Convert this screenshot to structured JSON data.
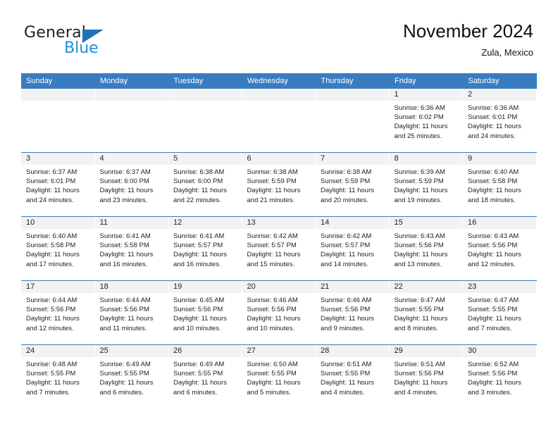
{
  "brand": {
    "name_primary": "General",
    "name_secondary": "Blue",
    "triangle_color": "#1f71b8",
    "secondary_color": "#1f8fd6"
  },
  "header": {
    "title": "November 2024",
    "subtitle": "Zula, Mexico"
  },
  "theme": {
    "header_row_bg": "#3a7cc0",
    "daynum_band_bg": "#f2f2f2",
    "grid_line": "#3a7cc0",
    "text": "#222222"
  },
  "weekday_headers": [
    "Sunday",
    "Monday",
    "Tuesday",
    "Wednesday",
    "Thursday",
    "Friday",
    "Saturday"
  ],
  "labels": {
    "sunrise_prefix": "Sunrise:",
    "sunset_prefix": "Sunset:",
    "daylight_prefix": "Daylight:"
  },
  "weeks": [
    [
      {
        "day": "",
        "empty": true
      },
      {
        "day": "",
        "empty": true
      },
      {
        "day": "",
        "empty": true
      },
      {
        "day": "",
        "empty": true
      },
      {
        "day": "",
        "empty": true
      },
      {
        "day": "1",
        "sunrise": "Sunrise: 6:36 AM",
        "sunset": "Sunset: 6:02 PM",
        "daylight": "Daylight: 11 hours and 25 minutes."
      },
      {
        "day": "2",
        "sunrise": "Sunrise: 6:36 AM",
        "sunset": "Sunset: 6:01 PM",
        "daylight": "Daylight: 11 hours and 24 minutes."
      }
    ],
    [
      {
        "day": "3",
        "sunrise": "Sunrise: 6:37 AM",
        "sunset": "Sunset: 6:01 PM",
        "daylight": "Daylight: 11 hours and 24 minutes."
      },
      {
        "day": "4",
        "sunrise": "Sunrise: 6:37 AM",
        "sunset": "Sunset: 6:00 PM",
        "daylight": "Daylight: 11 hours and 23 minutes."
      },
      {
        "day": "5",
        "sunrise": "Sunrise: 6:38 AM",
        "sunset": "Sunset: 6:00 PM",
        "daylight": "Daylight: 11 hours and 22 minutes."
      },
      {
        "day": "6",
        "sunrise": "Sunrise: 6:38 AM",
        "sunset": "Sunset: 5:59 PM",
        "daylight": "Daylight: 11 hours and 21 minutes."
      },
      {
        "day": "7",
        "sunrise": "Sunrise: 6:38 AM",
        "sunset": "Sunset: 5:59 PM",
        "daylight": "Daylight: 11 hours and 20 minutes."
      },
      {
        "day": "8",
        "sunrise": "Sunrise: 6:39 AM",
        "sunset": "Sunset: 5:59 PM",
        "daylight": "Daylight: 11 hours and 19 minutes."
      },
      {
        "day": "9",
        "sunrise": "Sunrise: 6:40 AM",
        "sunset": "Sunset: 5:58 PM",
        "daylight": "Daylight: 11 hours and 18 minutes."
      }
    ],
    [
      {
        "day": "10",
        "sunrise": "Sunrise: 6:40 AM",
        "sunset": "Sunset: 5:58 PM",
        "daylight": "Daylight: 11 hours and 17 minutes."
      },
      {
        "day": "11",
        "sunrise": "Sunrise: 6:41 AM",
        "sunset": "Sunset: 5:58 PM",
        "daylight": "Daylight: 11 hours and 16 minutes."
      },
      {
        "day": "12",
        "sunrise": "Sunrise: 6:41 AM",
        "sunset": "Sunset: 5:57 PM",
        "daylight": "Daylight: 11 hours and 16 minutes."
      },
      {
        "day": "13",
        "sunrise": "Sunrise: 6:42 AM",
        "sunset": "Sunset: 5:57 PM",
        "daylight": "Daylight: 11 hours and 15 minutes."
      },
      {
        "day": "14",
        "sunrise": "Sunrise: 6:42 AM",
        "sunset": "Sunset: 5:57 PM",
        "daylight": "Daylight: 11 hours and 14 minutes."
      },
      {
        "day": "15",
        "sunrise": "Sunrise: 6:43 AM",
        "sunset": "Sunset: 5:56 PM",
        "daylight": "Daylight: 11 hours and 13 minutes."
      },
      {
        "day": "16",
        "sunrise": "Sunrise: 6:43 AM",
        "sunset": "Sunset: 5:56 PM",
        "daylight": "Daylight: 11 hours and 12 minutes."
      }
    ],
    [
      {
        "day": "17",
        "sunrise": "Sunrise: 6:44 AM",
        "sunset": "Sunset: 5:56 PM",
        "daylight": "Daylight: 11 hours and 12 minutes."
      },
      {
        "day": "18",
        "sunrise": "Sunrise: 6:44 AM",
        "sunset": "Sunset: 5:56 PM",
        "daylight": "Daylight: 11 hours and 11 minutes."
      },
      {
        "day": "19",
        "sunrise": "Sunrise: 6:45 AM",
        "sunset": "Sunset: 5:56 PM",
        "daylight": "Daylight: 11 hours and 10 minutes."
      },
      {
        "day": "20",
        "sunrise": "Sunrise: 6:46 AM",
        "sunset": "Sunset: 5:56 PM",
        "daylight": "Daylight: 11 hours and 10 minutes."
      },
      {
        "day": "21",
        "sunrise": "Sunrise: 6:46 AM",
        "sunset": "Sunset: 5:56 PM",
        "daylight": "Daylight: 11 hours and 9 minutes."
      },
      {
        "day": "22",
        "sunrise": "Sunrise: 6:47 AM",
        "sunset": "Sunset: 5:55 PM",
        "daylight": "Daylight: 11 hours and 8 minutes."
      },
      {
        "day": "23",
        "sunrise": "Sunrise: 6:47 AM",
        "sunset": "Sunset: 5:55 PM",
        "daylight": "Daylight: 11 hours and 7 minutes."
      }
    ],
    [
      {
        "day": "24",
        "sunrise": "Sunrise: 6:48 AM",
        "sunset": "Sunset: 5:55 PM",
        "daylight": "Daylight: 11 hours and 7 minutes."
      },
      {
        "day": "25",
        "sunrise": "Sunrise: 6:49 AM",
        "sunset": "Sunset: 5:55 PM",
        "daylight": "Daylight: 11 hours and 6 minutes."
      },
      {
        "day": "26",
        "sunrise": "Sunrise: 6:49 AM",
        "sunset": "Sunset: 5:55 PM",
        "daylight": "Daylight: 11 hours and 6 minutes."
      },
      {
        "day": "27",
        "sunrise": "Sunrise: 6:50 AM",
        "sunset": "Sunset: 5:55 PM",
        "daylight": "Daylight: 11 hours and 5 minutes."
      },
      {
        "day": "28",
        "sunrise": "Sunrise: 6:51 AM",
        "sunset": "Sunset: 5:55 PM",
        "daylight": "Daylight: 11 hours and 4 minutes."
      },
      {
        "day": "29",
        "sunrise": "Sunrise: 6:51 AM",
        "sunset": "Sunset: 5:56 PM",
        "daylight": "Daylight: 11 hours and 4 minutes."
      },
      {
        "day": "30",
        "sunrise": "Sunrise: 6:52 AM",
        "sunset": "Sunset: 5:56 PM",
        "daylight": "Daylight: 11 hours and 3 minutes."
      }
    ]
  ]
}
